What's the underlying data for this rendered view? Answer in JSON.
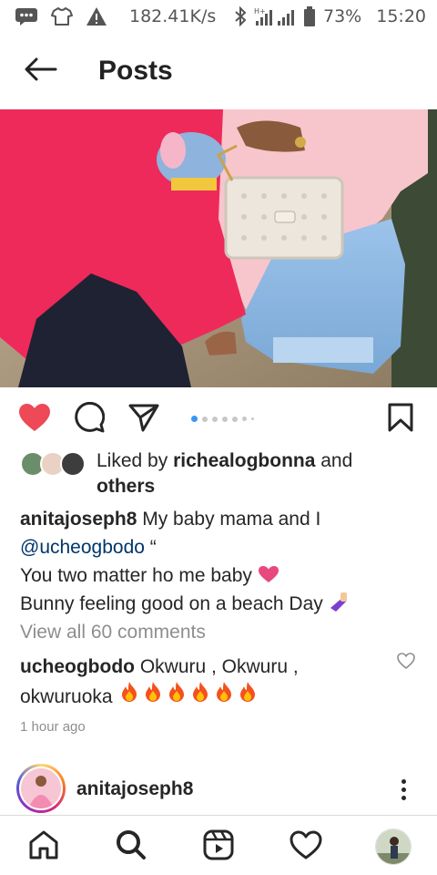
{
  "status_bar": {
    "speed": "182.41K/s",
    "battery": "73%",
    "time": "15:20",
    "icons": [
      "message-icon",
      "tshirt-icon",
      "warning-icon",
      "bluetooth-icon",
      "signal-icon",
      "battery-icon"
    ]
  },
  "header": {
    "title": "Posts",
    "back_icon": "arrow-left-icon"
  },
  "post": {
    "likes": {
      "prefix": "Liked by ",
      "user": "richealogbonna",
      "middle": " and",
      "others": "others"
    },
    "caption": {
      "username": "anitajoseph8",
      "line1": " My baby mama and I",
      "mention": "@ucheogbodo",
      "mention_suffix": " “",
      "line2": "You two matter ho me baby ",
      "line3": "Bunny feeling good on a beach Day "
    },
    "view_comments": "View all 60 comments",
    "comment": {
      "username": "ucheogbodo",
      "text": " Okwuru , Okwuru ,",
      "text2": "okwuruoka "
    },
    "time": "1 hour ago",
    "carousel": {
      "count": 7,
      "active_index": 0
    },
    "liked": true
  },
  "next_post": {
    "username": "anitajoseph8"
  },
  "colors": {
    "like_red": "#ed4956",
    "carousel_blue": "#3897f0",
    "text": "#262626",
    "muted": "#8e8e8e",
    "mention": "#00376b"
  },
  "bottom_nav": [
    "home-icon",
    "search-icon",
    "reels-icon",
    "heart-icon",
    "profile-avatar"
  ]
}
